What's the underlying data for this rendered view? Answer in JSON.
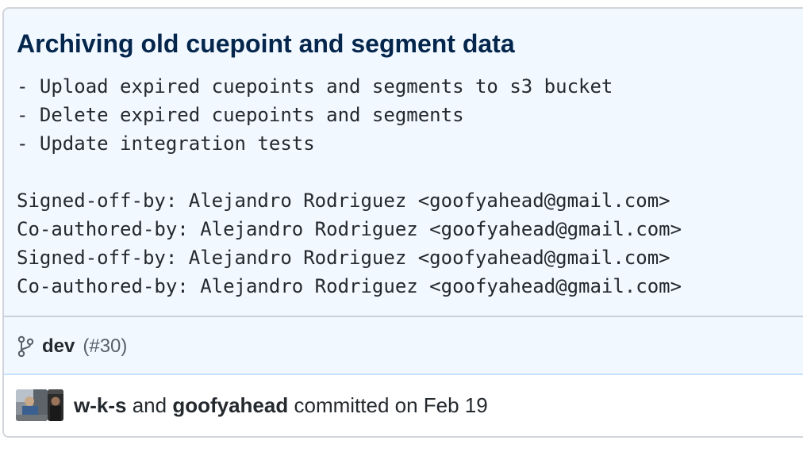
{
  "commit": {
    "title": "Archiving old cuepoint and segment data",
    "description": "- Upload expired cuepoints and segments to s3 bucket\n- Delete expired cuepoints and segments\n- Update integration tests\n\nSigned-off-by: Alejandro Rodriguez <goofyahead@gmail.com>\nCo-authored-by: Alejandro Rodriguez <goofyahead@gmail.com>\nSigned-off-by: Alejandro Rodriguez <goofyahead@gmail.com>\nCo-authored-by: Alejandro Rodriguez <goofyahead@gmail.com>",
    "branch": "dev",
    "pr_ref": "(#30)",
    "author1": "w-k-s",
    "and_word": "and",
    "author2": "goofyahead",
    "committed_text": "committed on Feb 19"
  },
  "icons": {
    "branch": "git-branch-icon",
    "avatar1": "user-avatar",
    "avatar2": "user-avatar"
  },
  "colors": {
    "box_background": "#f1f8ff",
    "title": "#05264c",
    "border": "#d1d5da",
    "muted": "#586069"
  }
}
